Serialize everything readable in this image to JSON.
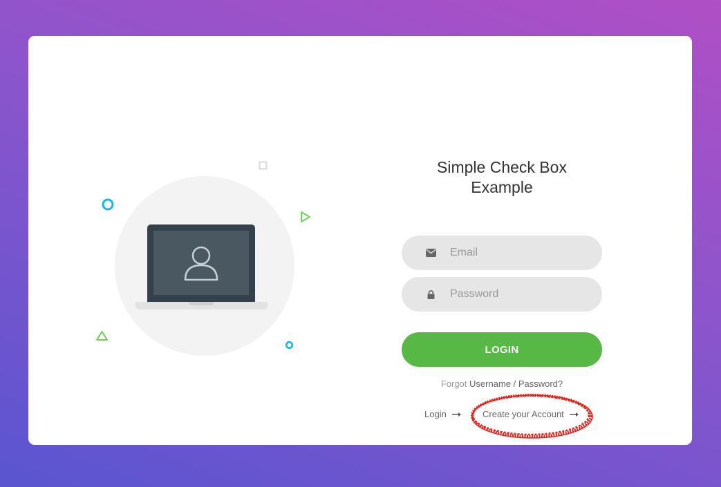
{
  "page": {
    "title_line1": "Simple Check Box",
    "title_line2": "Example"
  },
  "form": {
    "email_placeholder": "Email",
    "password_placeholder": "Password",
    "email_icon": "envelope-icon",
    "password_icon": "lock-icon",
    "login_button_label": "LOGIN",
    "forgot_prefix": "Forgot",
    "forgot_link": "Username / Password?"
  },
  "links": {
    "login_label": "Login",
    "create_account_label": "Create your Account",
    "arrow_icon": "arrow-right-icon"
  },
  "illustration": {
    "icon": "laptop-user-icon"
  },
  "colors": {
    "accent_green": "#57b846",
    "field_bg": "#e6e6e6",
    "annotation_red": "#e8221a",
    "deco_cyan": "#17b9e0",
    "deco_green": "#6fd058"
  }
}
